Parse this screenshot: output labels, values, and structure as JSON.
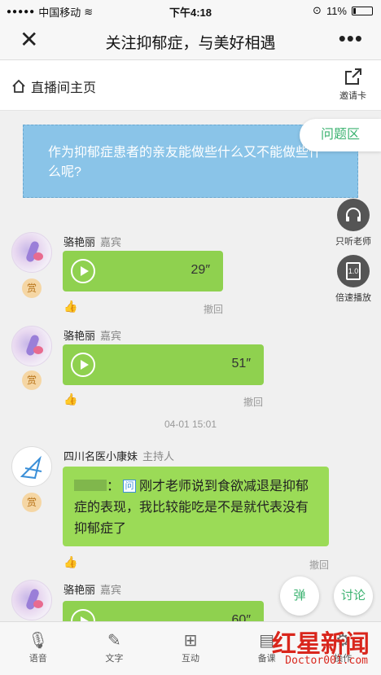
{
  "status_bar": {
    "carrier": "中国移动",
    "time": "下午4:18",
    "battery": "11%"
  },
  "nav": {
    "title": "关注抑郁症，与美好相遇"
  },
  "sub_header": {
    "home_label": "直播间主页",
    "invite_label": "邀请卡"
  },
  "question_card": {
    "text": "作为抑郁症患者的亲友能做些什么又不能做些什么呢?",
    "tab_label": "问题区"
  },
  "side_buttons": {
    "listen_label": "只听老师",
    "speed_label": "倍速播放",
    "speed_value": "1.0"
  },
  "messages": [
    {
      "name": "骆艳丽",
      "role": "嘉宾",
      "duration": "29″",
      "recall": "撤回",
      "reward": "赏"
    },
    {
      "name": "骆艳丽",
      "role": "嘉宾",
      "duration": "51″",
      "recall": "撤回",
      "reward": "赏"
    },
    {
      "name": "四川名医小康妹",
      "role": "主持人",
      "question_badge": "问",
      "text": "刚才老师说到食欲减退是抑郁症的表现，我比较能吃是不是就代表没有抑郁症了",
      "recall": "撤回",
      "reward": "赏"
    },
    {
      "name": "骆艳丽",
      "role": "嘉宾",
      "duration": "60″"
    }
  ],
  "timestamp": "04-01 15:01",
  "fab": {
    "danmu": "弹",
    "discuss": "讨论"
  },
  "tabs": [
    {
      "label": "语音",
      "icon": "microphone-icon"
    },
    {
      "label": "文字",
      "icon": "pen-icon"
    },
    {
      "label": "互动",
      "icon": "grid-icon"
    },
    {
      "label": "备课",
      "icon": "book-icon"
    },
    {
      "label": "操作",
      "icon": "settings-icon"
    }
  ],
  "watermark": {
    "logo": "红星新闻",
    "site": "Doctor001.com"
  },
  "colors": {
    "green_bubble": "#8fd14f",
    "question_blue": "#8ac4e8",
    "accent_green": "#3cb371"
  }
}
